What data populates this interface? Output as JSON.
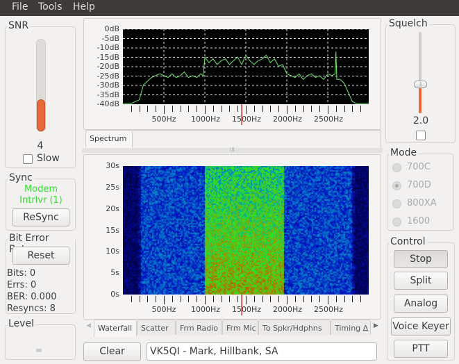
{
  "menu": [
    "File",
    "Tools",
    "Help"
  ],
  "snr": {
    "title": "SNR",
    "value": "4",
    "level_percent": 35,
    "slow_label": "Slow",
    "slow_checked": false
  },
  "sync": {
    "title": "Sync",
    "status1": "Modem",
    "status2": "Intrlvr (1)",
    "resync_label": "ReSync",
    "status_color": "#33dd33"
  },
  "ber": {
    "title": "Bit Error Rate",
    "reset_label": "Reset",
    "bits": "Bits: 0",
    "errs": "Errs: 0",
    "ber": "BER: 0.000",
    "resyncs": "Resyncs: 8"
  },
  "level": {
    "title": "Level"
  },
  "spectrum": {
    "tab": "Spectrum",
    "y_ticks": [
      "0dB",
      "-5dB",
      "-10dB",
      "-15dB",
      "-20dB",
      "-25dB",
      "-30dB",
      "-35dB",
      "-40dB"
    ],
    "x_ticks": [
      "500Hz",
      "1000Hz",
      "1500Hz",
      "2000Hz",
      "2500Hz"
    ],
    "xlim": [
      0,
      3000
    ],
    "ylim": [
      -40,
      0
    ],
    "line_color": "#6ee66e",
    "marker_hz": 1450,
    "marker_color": "#e06060",
    "freq_hz": [
      0,
      100,
      200,
      250,
      300,
      350,
      400,
      450,
      500,
      550,
      600,
      650,
      700,
      750,
      800,
      850,
      900,
      950,
      980,
      1000,
      1050,
      1100,
      1150,
      1200,
      1250,
      1300,
      1350,
      1400,
      1450,
      1500,
      1550,
      1600,
      1650,
      1700,
      1750,
      1800,
      1850,
      1900,
      1950,
      2000,
      2050,
      2100,
      2150,
      2200,
      2250,
      2300,
      2350,
      2400,
      2450,
      2500,
      2550,
      2590,
      2600,
      2610,
      2650,
      2700,
      2750,
      2800,
      2850,
      3000
    ],
    "level_db": [
      -40,
      -40,
      -38,
      -30,
      -28,
      -26,
      -25,
      -24,
      -25,
      -26,
      -24,
      -26,
      -25,
      -23,
      -26,
      -25,
      -26,
      -24,
      -25,
      -15,
      -18,
      -16,
      -19,
      -17,
      -16,
      -19,
      -17,
      -15,
      -19,
      -14,
      -17,
      -19,
      -17,
      -16,
      -14,
      -18,
      -16,
      -20,
      -19,
      -24,
      -25,
      -26,
      -24,
      -27,
      -25,
      -24,
      -26,
      -25,
      -27,
      -24,
      -25,
      -24,
      -12,
      -27,
      -27,
      -29,
      -34,
      -39,
      -40,
      -40
    ]
  },
  "waterfall": {
    "y_ticks": [
      "30s",
      "25s",
      "20s",
      "15s",
      "10s",
      "5s",
      "0s"
    ],
    "x_ticks": [
      "500Hz",
      "1000Hz",
      "1500Hz",
      "2000Hz",
      "2500Hz"
    ],
    "tabs": [
      "Waterfall",
      "Scatter",
      "Frm Radio",
      "Frm Mic",
      "To Spkr/Hdphns",
      "Timing Δ"
    ],
    "active_tab": 0,
    "signal_band_hz": [
      1000,
      1950
    ],
    "carrier_hz": 2600
  },
  "bottom": {
    "clear_label": "Clear",
    "text_value": "VK5QI - Mark, Hillbank, SA"
  },
  "squelch": {
    "title": "Squelch",
    "value": "2.0",
    "level_percent": 35,
    "checked": false
  },
  "mode": {
    "title": "Mode",
    "options": [
      "700C",
      "700D",
      "800XA",
      "1600"
    ],
    "selected": "700D"
  },
  "control": {
    "title": "Control",
    "buttons": [
      "Stop",
      "Split",
      "Analog",
      "Voice Keyer",
      "PTT"
    ]
  }
}
